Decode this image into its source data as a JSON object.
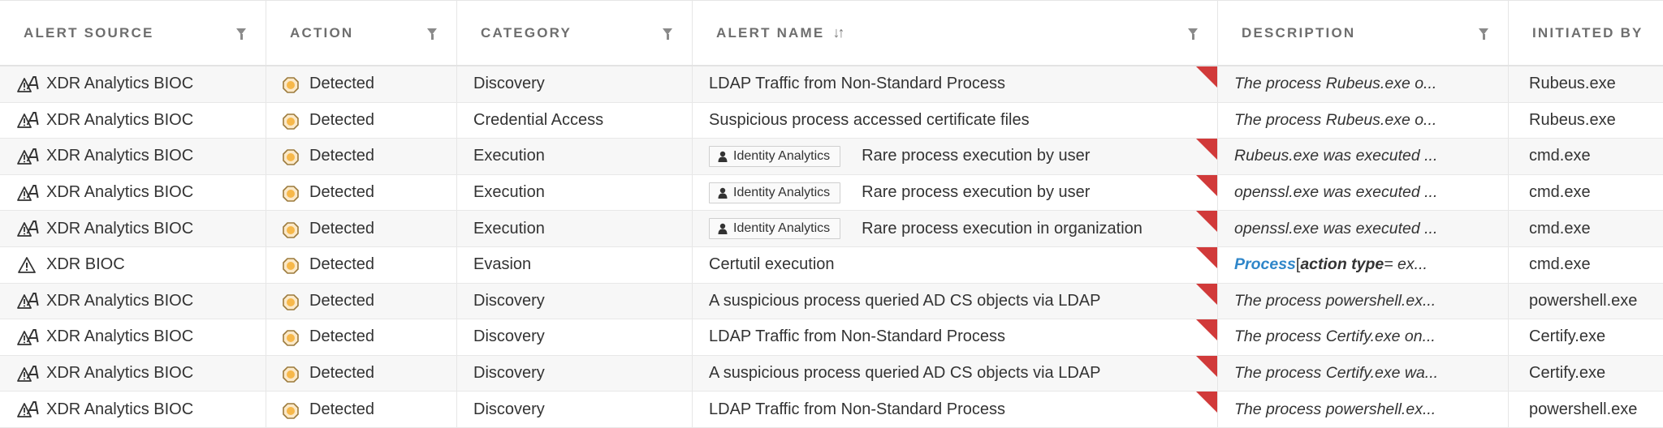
{
  "columns": [
    {
      "label": "ALERT SOURCE",
      "filter": true
    },
    {
      "label": "ACTION",
      "filter": true
    },
    {
      "label": "CATEGORY",
      "filter": true
    },
    {
      "label": "ALERT NAME",
      "filter": true,
      "sort_icon": "sort-arrows-icon"
    },
    {
      "label": "DESCRIPTION",
      "filter": true
    },
    {
      "label": "INITIATED BY",
      "filter": false
    }
  ],
  "colors": {
    "flag": "#d13a3a",
    "link": "#2f86c9",
    "detected_fill": "#f7b84a",
    "detected_ring": "#9c7a3c",
    "row_alt": "#f7f7f7"
  },
  "rows": [
    {
      "source": "XDR Analytics BIOC",
      "source_icon": "analytics-warning-icon",
      "action": "Detected",
      "category": "Discovery",
      "tag": null,
      "alert_name": "LDAP Traffic from Non-Standard Process",
      "flag": true,
      "description": "The process Rubeus.exe o...",
      "initiated_by": "Rubeus.exe"
    },
    {
      "source": "XDR Analytics BIOC",
      "source_icon": "analytics-warning-icon",
      "action": "Detected",
      "category": "Credential Access",
      "tag": null,
      "alert_name": "Suspicious process accessed certificate files",
      "flag": false,
      "description": "The process Rubeus.exe o...",
      "initiated_by": "Rubeus.exe"
    },
    {
      "source": "XDR Analytics BIOC",
      "source_icon": "analytics-warning-icon",
      "action": "Detected",
      "category": "Execution",
      "tag": "Identity Analytics",
      "alert_name": "Rare process execution by user",
      "flag": true,
      "description": "Rubeus.exe was executed ...",
      "initiated_by": "cmd.exe"
    },
    {
      "source": "XDR Analytics BIOC",
      "source_icon": "analytics-warning-icon",
      "action": "Detected",
      "category": "Execution",
      "tag": "Identity Analytics",
      "alert_name": "Rare process execution by user",
      "flag": true,
      "description": "openssl.exe was executed ...",
      "initiated_by": "cmd.exe"
    },
    {
      "source": "XDR Analytics BIOC",
      "source_icon": "analytics-warning-icon",
      "action": "Detected",
      "category": "Execution",
      "tag": "Identity Analytics",
      "alert_name": "Rare process execution in organization",
      "flag": true,
      "description": "openssl.exe was executed ...",
      "initiated_by": "cmd.exe"
    },
    {
      "source": "XDR BIOC",
      "source_icon": "warning-icon",
      "action": "Detected",
      "category": "Evasion",
      "tag": null,
      "alert_name": "Certutil execution",
      "flag": true,
      "description": null,
      "description_parts": {
        "link": "Process",
        "bracket": " [ ",
        "bold": "action type",
        "rest": " = ex..."
      },
      "initiated_by": "cmd.exe"
    },
    {
      "source": "XDR Analytics BIOC",
      "source_icon": "analytics-warning-icon",
      "action": "Detected",
      "category": "Discovery",
      "tag": null,
      "alert_name": "A suspicious process queried AD CS objects via LDAP",
      "flag": true,
      "description": "The process powershell.ex...",
      "initiated_by": "powershell.exe"
    },
    {
      "source": "XDR Analytics BIOC",
      "source_icon": "analytics-warning-icon",
      "action": "Detected",
      "category": "Discovery",
      "tag": null,
      "alert_name": "LDAP Traffic from Non-Standard Process",
      "flag": true,
      "description": "The process Certify.exe on...",
      "initiated_by": "Certify.exe"
    },
    {
      "source": "XDR Analytics BIOC",
      "source_icon": "analytics-warning-icon",
      "action": "Detected",
      "category": "Discovery",
      "tag": null,
      "alert_name": "A suspicious process queried AD CS objects via LDAP",
      "flag": true,
      "description": "The process Certify.exe wa...",
      "initiated_by": "Certify.exe"
    },
    {
      "source": "XDR Analytics BIOC",
      "source_icon": "analytics-warning-icon",
      "action": "Detected",
      "category": "Discovery",
      "tag": null,
      "alert_name": "LDAP Traffic from Non-Standard Process",
      "flag": true,
      "description": "The process powershell.ex...",
      "initiated_by": "powershell.exe"
    }
  ]
}
